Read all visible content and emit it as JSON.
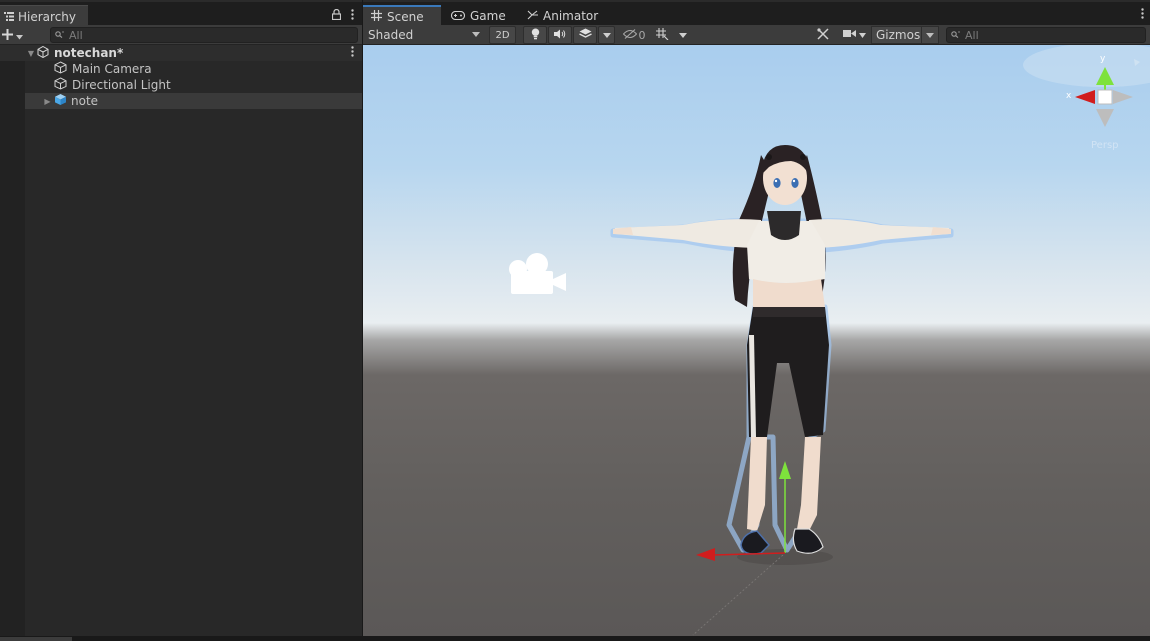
{
  "hierarchy": {
    "tab_label": "Hierarchy",
    "search_placeholder": "All",
    "scene_name": "notechan*",
    "items": [
      {
        "label": "Main Camera",
        "icon": "gameobject-cube-icon"
      },
      {
        "label": "Directional Light",
        "icon": "gameobject-cube-icon"
      },
      {
        "label": "note",
        "icon": "prefab-cube-icon",
        "selected": true,
        "collapsed": true
      }
    ]
  },
  "scene_view": {
    "tabs": [
      {
        "label": "Scene",
        "icon": "grid-icon",
        "active": true
      },
      {
        "label": "Game",
        "icon": "gamepad-icon"
      },
      {
        "label": "Animator",
        "icon": "animator-icon"
      }
    ],
    "toolbar": {
      "shading_mode": "Shaded",
      "toggle_2d": "2D",
      "hidden_count": "0",
      "gizmos": "Gizmos",
      "search_placeholder": "All"
    },
    "orientation_gizmo": {
      "x_label": "x",
      "y_label": "y",
      "projection": "Persp"
    }
  },
  "colors": {
    "accent_blue": "#3a79bb",
    "axis_x": "#d11d1d",
    "axis_y": "#7ee23c",
    "panel_bg": "#282828",
    "toolbar_bg": "#3c3c3c"
  }
}
